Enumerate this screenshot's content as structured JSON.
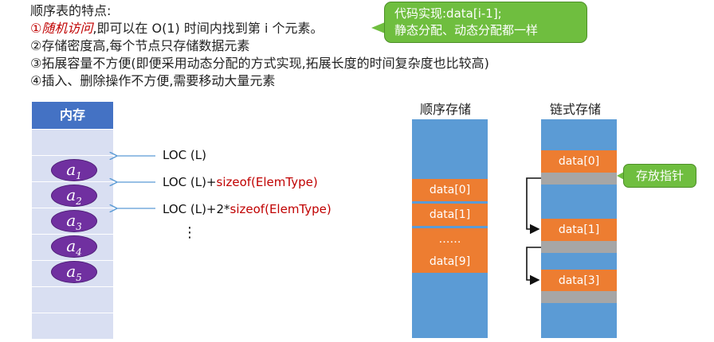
{
  "features": {
    "heading": "顺序表的特点:",
    "item1_num": "①",
    "item1_em": "随机访问",
    "item1_rest": ",即可以在 O(1) 时间内找到第 i 个元素。",
    "item2": "②存储密度高,每个节点只存储数据元素",
    "item3": "③拓展容量不方便(即便采用动态分配的方式实现,拓展长度的时间复杂度也比较高)",
    "item4": "④插入、删除操作不方便,需要移动大量元素"
  },
  "callout": {
    "line1": "代码实现:data[i-1];",
    "line2": "静态分配、动态分配都一样"
  },
  "memory": {
    "title": "内存",
    "elements": [
      "a",
      "a",
      "a",
      "a",
      "a"
    ],
    "subscripts": [
      "1",
      "2",
      "3",
      "4",
      "5"
    ],
    "loc0": "LOC (L)",
    "loc1_prefix": "LOC (L)+",
    "loc1_fn": "sizeof(ElemType)",
    "loc2_prefix": "LOC (L)+2*",
    "loc2_fn": "sizeof(ElemType)",
    "dots": "⋮"
  },
  "sequential": {
    "title": "顺序存储",
    "cells": [
      "data[0]",
      "data[1]",
      "……",
      "data[9]"
    ]
  },
  "linked": {
    "title": "链式存储",
    "cells": [
      "data[0]",
      "data[1]",
      "data[3]"
    ],
    "pointer_label": "存放指针"
  },
  "colors": {
    "blue": "#5b9bd5",
    "orange": "#ed7d31",
    "gray": "#a6a6a6",
    "green": "#6fbe3f",
    "purple": "#7030a0",
    "red": "#c00000"
  }
}
